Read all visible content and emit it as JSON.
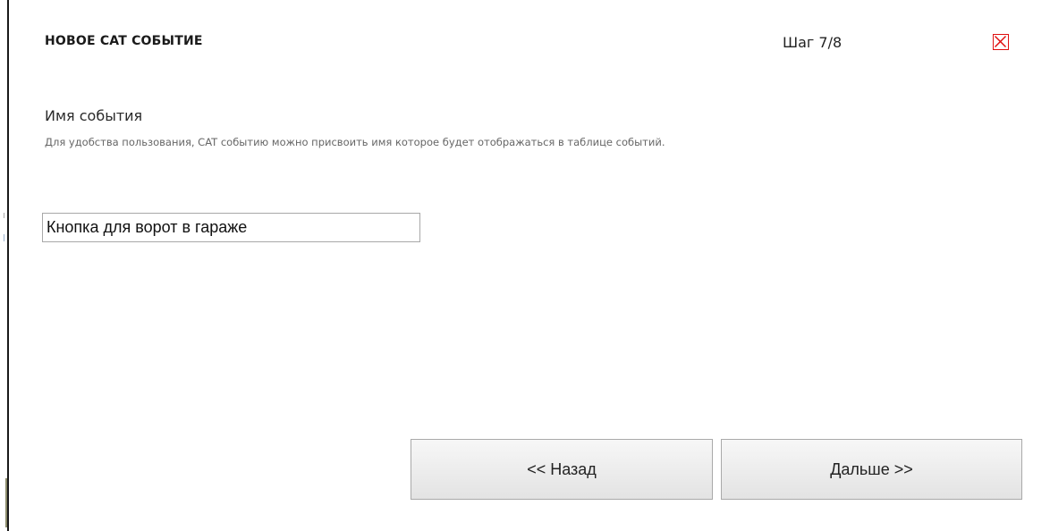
{
  "dialog": {
    "title": "НОВОЕ CAT СОБЫТИЕ",
    "step": "Шаг 7/8",
    "close_icon": "close-icon"
  },
  "section": {
    "heading": "Имя события",
    "description": "Для удобства пользования, CAT событию можно присвоить имя которое будет отображаться в таблице событий."
  },
  "event_name": {
    "value": "Кнопка для ворот в гараже"
  },
  "buttons": {
    "back_label": "<< Назад",
    "next_label": "Дальше >>"
  },
  "colors": {
    "close_accent": "#e01010",
    "button_border": "#a9a9a9"
  }
}
